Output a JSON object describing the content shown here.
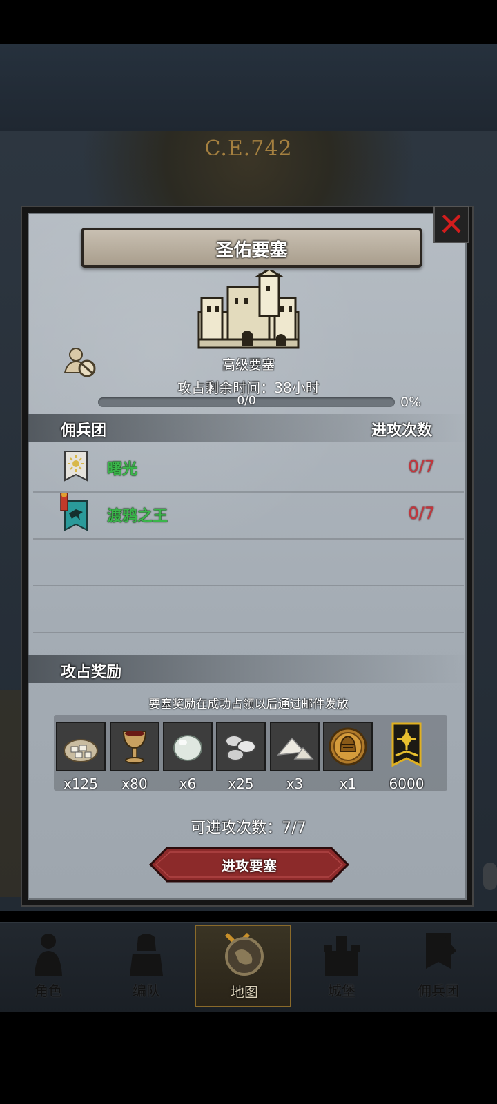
{
  "map": {
    "era_label": "C.E.742"
  },
  "dialog": {
    "title": "圣佑要塞",
    "fortress_type": "高级要塞",
    "time_label": "攻占剩余时间：38小时",
    "progress_text": "0/0",
    "progress_percent": "0%",
    "progress_value": 0
  },
  "mercenaries": {
    "header": "佣兵团",
    "count_header": "进攻次数",
    "rows": [
      {
        "name": "曙光",
        "count": "0/7",
        "icon": "sun-banner-icon"
      },
      {
        "name": "渡鸦之王",
        "count": "0/7",
        "icon": "raven-banner-icon"
      }
    ]
  },
  "rewards": {
    "header": "攻占奖励",
    "note": "要塞奖励在成功占领以后通过邮件发放",
    "items": [
      {
        "icon": "cloth-sack-icon",
        "qty": "x125"
      },
      {
        "icon": "goblet-icon",
        "qty": "x80"
      },
      {
        "icon": "pearl-icon",
        "qty": "x6"
      },
      {
        "icon": "silver-ore-icon",
        "qty": "x25"
      },
      {
        "icon": "salt-pile-icon",
        "qty": "x3"
      },
      {
        "icon": "golden-helmet-icon",
        "qty": "x1"
      }
    ],
    "banner": {
      "icon": "guild-banner-icon",
      "qty": "6000"
    }
  },
  "attempts_label": "可进攻次数：7/7",
  "attack_button": "进攻要塞",
  "nav": {
    "items": [
      {
        "label": "角色",
        "icon": "character-icon"
      },
      {
        "label": "编队",
        "icon": "formation-icon"
      },
      {
        "label": "地图",
        "icon": "map-icon"
      },
      {
        "label": "城堡",
        "icon": "castle-icon"
      },
      {
        "label": "佣兵团",
        "icon": "mercenary-icon"
      }
    ],
    "active": "地图"
  },
  "colors": {
    "merc_name": "#3ab54a",
    "count_red": "#c6343b",
    "close_red": "#d21d1d",
    "button_red": "#8c2a2a",
    "panel_bg": "#a9b0b8"
  }
}
